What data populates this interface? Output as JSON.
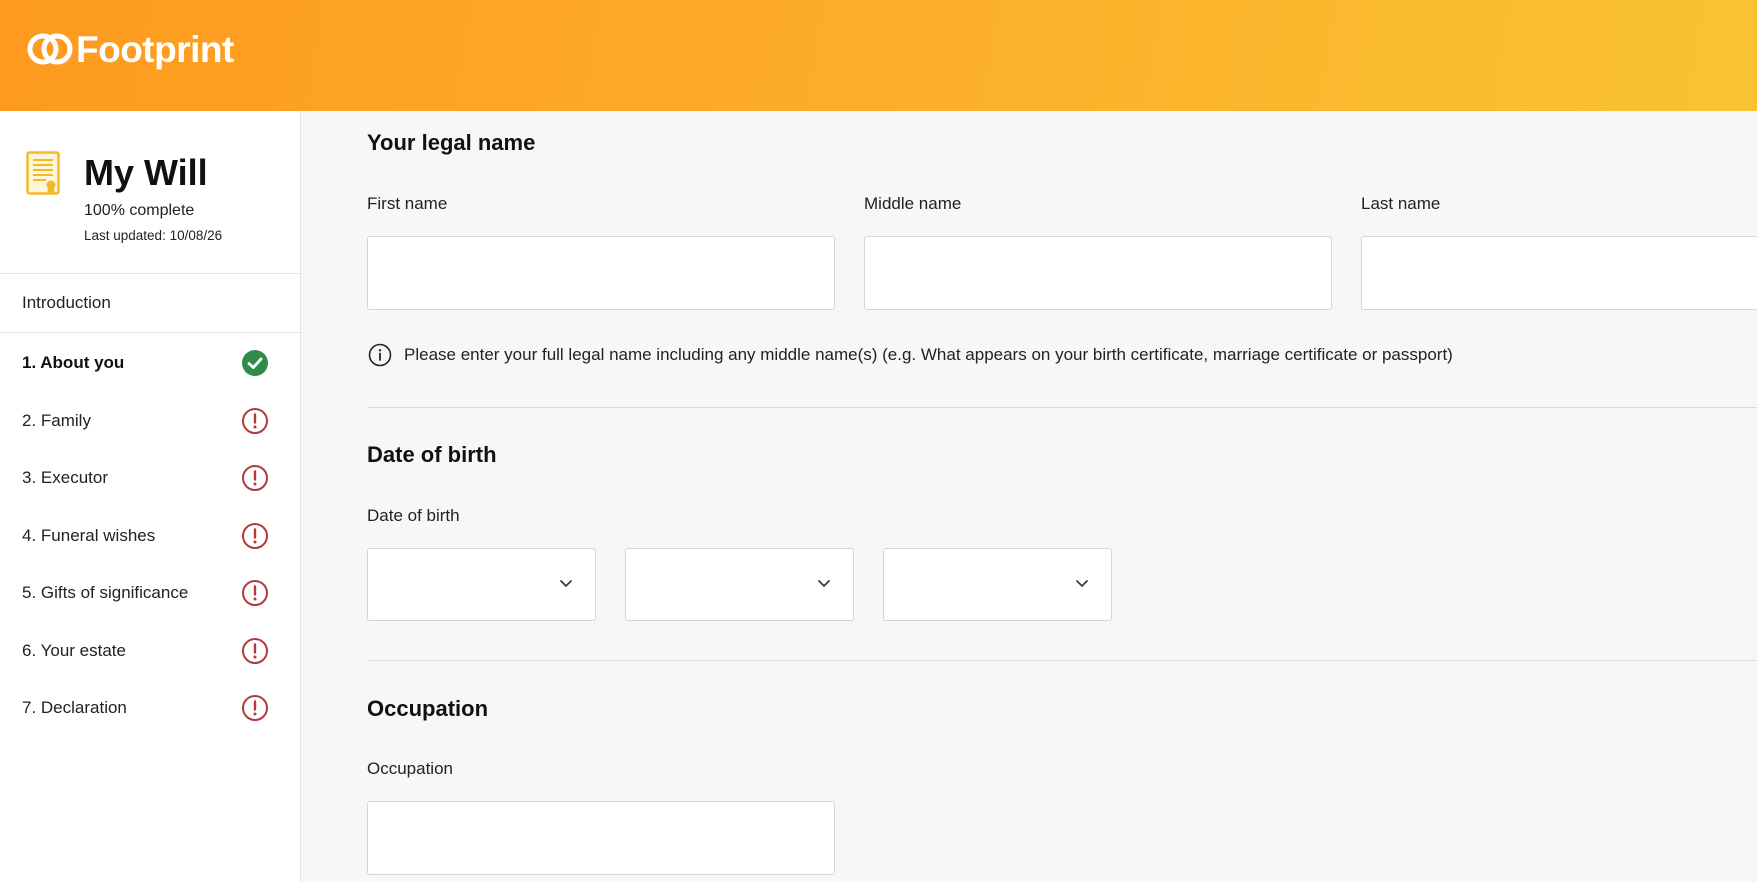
{
  "brand": {
    "name": "Footprint",
    "accent": "#fd9a1f"
  },
  "will": {
    "title": "My Will",
    "progress": "100% complete",
    "last_updated": "Last updated: 10/08/26"
  },
  "sidebar": {
    "intro_label": "Introduction",
    "items": [
      {
        "label": "1. About you",
        "status": "complete",
        "icon": "check-circle-icon",
        "active": true
      },
      {
        "label": "2. Family",
        "status": "incomplete",
        "icon": "alert-circle-icon"
      },
      {
        "label": "3. Executor",
        "status": "incomplete",
        "icon": "alert-circle-icon"
      },
      {
        "label": "4. Funeral wishes",
        "status": "incomplete",
        "icon": "alert-circle-icon"
      },
      {
        "label": "5. Gifts of significance",
        "status": "incomplete",
        "icon": "alert-circle-icon"
      },
      {
        "label": "6. Your estate",
        "status": "incomplete",
        "icon": "alert-circle-icon"
      },
      {
        "label": "7. Declaration",
        "status": "incomplete",
        "icon": "alert-circle-icon"
      }
    ],
    "colors": {
      "complete": "#2e8b4a",
      "incomplete": "#b23a3a"
    }
  },
  "legal_name": {
    "title": "Your legal name",
    "first_label": "First name",
    "first_value": "",
    "middle_label": "Middle name",
    "middle_value": "",
    "last_label": "Last name",
    "last_value": "",
    "info_text": "Please enter your full legal name including any middle name(s) (e.g. What appears on your birth certificate, marriage certificate or passport)"
  },
  "dob": {
    "title": "Date of birth",
    "label": "Date of birth",
    "day_value": "",
    "month_value": "",
    "year_value": ""
  },
  "occupation": {
    "title": "Occupation",
    "label": "Occupation",
    "value": ""
  }
}
